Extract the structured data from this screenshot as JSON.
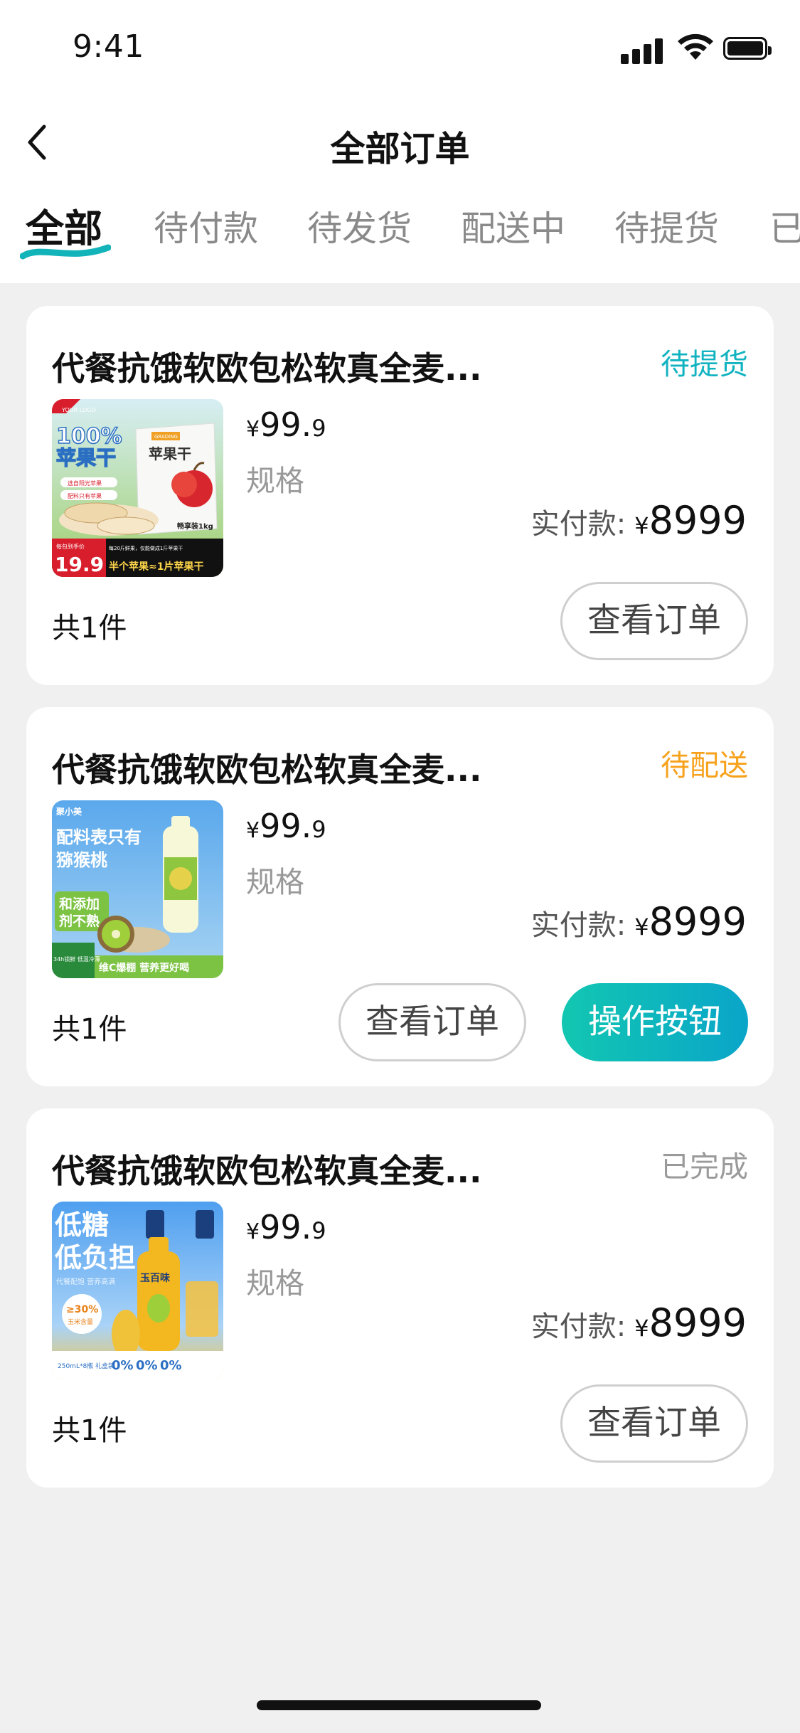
{
  "status_bar": {
    "time": "9:41"
  },
  "nav": {
    "title": "全部订单"
  },
  "tabs": [
    {
      "label": "全部",
      "active": true
    },
    {
      "label": "待付款"
    },
    {
      "label": "待发货"
    },
    {
      "label": "配送中"
    },
    {
      "label": "待提货"
    },
    {
      "label": "已"
    }
  ],
  "orders": [
    {
      "title": "代餐抗饿软欧包松软真全麦...",
      "status": "待提货",
      "status_color": "#12b3c1",
      "price_symbol": "¥",
      "price_int": "99.",
      "price_dec": "9",
      "spec": "规格",
      "paid_label": "实付款:",
      "paid_symbol": "¥",
      "paid_amount": "8999",
      "count": "共1件",
      "view_button": "查看订单",
      "image_text": {
        "logo": "YOUR LOGO",
        "badge": "100%",
        "headline": "苹果干",
        "bag_brand": "GRADING",
        "bag_title": "苹果干",
        "bullet1": "选自阳光苹果",
        "bullet2": "配料只有苹果",
        "pack": "畅享装1kg",
        "price_tag": "每包到手价",
        "price": "19.9",
        "price_unit": "袋",
        "promo": "每20斤鲜果，仅能做成1斤苹果干",
        "footer": "半个苹果≈1片苹果干"
      }
    },
    {
      "title": "代餐抗饿软欧包松软真全麦...",
      "status": "待配送",
      "status_color": "#f7a21c",
      "price_symbol": "¥",
      "price_int": "99.",
      "price_dec": "9",
      "spec": "规格",
      "paid_label": "实付款:",
      "paid_symbol": "¥",
      "paid_amount": "8999",
      "count": "共1件",
      "view_button": "查看订单",
      "action_button": "操作按钮",
      "image_text": {
        "brand": "聚小美",
        "line1": "配料表只有",
        "line2": "猕猴桃",
        "tag1": "和添加",
        "tag2": "剂不熟",
        "corner": "34h锁鲜 低温冷薄",
        "footer": "维C爆棚 营养更好喝"
      }
    },
    {
      "title": "代餐抗饿软欧包松软真全麦...",
      "status": "已完成",
      "status_color": "#9a9a9a",
      "price_symbol": "¥",
      "price_int": "99.",
      "price_dec": "9",
      "spec": "规格",
      "paid_label": "实付款:",
      "paid_symbol": "¥",
      "paid_amount": "8999",
      "count": "共1件",
      "view_button": "查看订单",
      "image_text": {
        "line1": "低糖",
        "line2": "低负担",
        "sub": "代餐配饱 营养高满",
        "badge_pct": "≥30%",
        "badge_txt": "玉米含量",
        "bottle": "玉百味",
        "pack": "250mL*8瓶 礼盒装",
        "zero": "0%"
      }
    }
  ]
}
